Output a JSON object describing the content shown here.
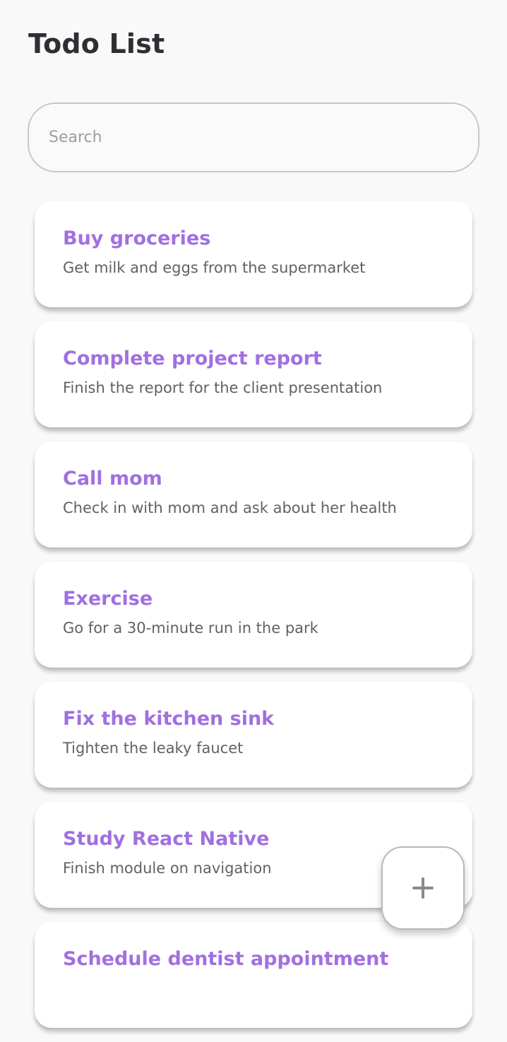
{
  "header": {
    "title": "Todo List"
  },
  "search": {
    "placeholder": "Search",
    "value": ""
  },
  "todos": [
    {
      "title": "Buy groceries",
      "description": "Get milk and eggs from the supermarket"
    },
    {
      "title": "Complete project report",
      "description": "Finish the report for the client presentation"
    },
    {
      "title": "Call mom",
      "description": "Check in with mom and ask about her health"
    },
    {
      "title": "Exercise",
      "description": "Go for a 30-minute run in the park"
    },
    {
      "title": "Fix the kitchen sink",
      "description": "Tighten the leaky faucet"
    },
    {
      "title": "Study React Native",
      "description": "Finish module on navigation"
    },
    {
      "title": "Schedule dentist appointment",
      "description": ""
    }
  ],
  "fab": {
    "icon": "plus-icon"
  },
  "colors": {
    "accent": "#a070e0",
    "background": "#f9f9fa",
    "card": "#ffffff",
    "title_text": "#2f2f33",
    "body_text": "#616166"
  }
}
